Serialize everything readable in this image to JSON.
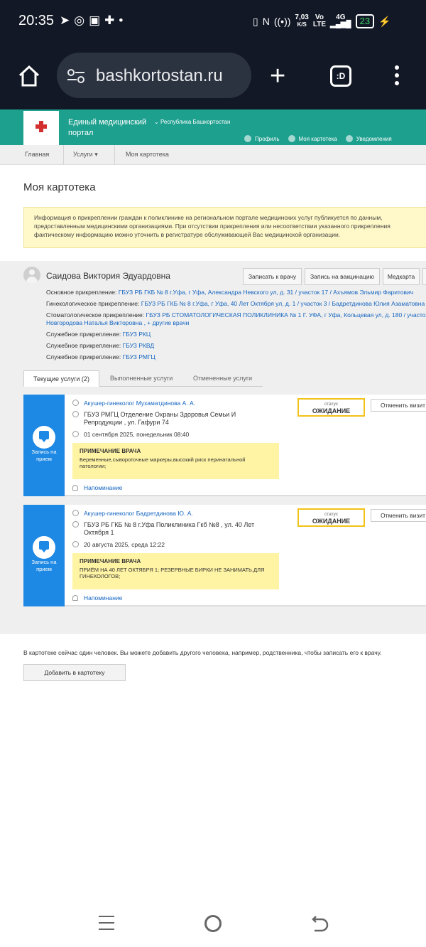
{
  "status_bar": {
    "time": "20:35",
    "notif_icons": [
      "telegram-icon",
      "whatsapp-icon",
      "app-icon",
      "plus-icon",
      "dot-icon"
    ],
    "net_speed_value": "7,03",
    "net_speed_unit": "K/S",
    "volte_top": "Vo",
    "volte_bottom": "LTE",
    "network": "4G",
    "battery": "23"
  },
  "browser": {
    "url": "bashkortostan.ru",
    "tabs_label": ":D"
  },
  "site_header": {
    "portal_name": "Единый медицинский портал",
    "region": "Республика Башкортостан",
    "links": [
      "Профиль",
      "Моя картотека",
      "Уведомления"
    ]
  },
  "breadcrumb": [
    "Главная",
    "Услуги",
    "Моя картотека"
  ],
  "page_title": "Моя картотека",
  "info_text": "Информация о прикреплении граждан к поликлинике на региональном портале медицинских услуг публикуется по данным, предоставленным медицинскими организациями. При отсутствии прикрепления или несоответствии указанного прикрепления фактическому информацию можно уточнить в регистратуре обслуживающей Вас медицинской организации.",
  "patient": {
    "name": "Саидова Виктория Эдуардовна",
    "buttons": [
      "Записать к врачу",
      "Запись на вакцинацию",
      "Медкарта"
    ],
    "attachments": [
      {
        "label": "Основное прикрепление:",
        "value": "ГБУЗ РБ ГКБ № 8 г.Уфа, г Уфа, Александра Невского ул, д. 31 / участок 17 / Ахъямов Эльмир Фаритович"
      },
      {
        "label": "Гинекологическое прикрепление:",
        "value": "ГБУЗ РБ ГКБ № 8 г.Уфа, г Уфа, 40 Лет Октября ул, д. 1 / участок 3 / Бадретдинова Юлия Азаматовна"
      },
      {
        "label": "Стоматологическое прикрепление:",
        "value": "ГБУЗ РБ СТОМАТОЛОГИЧЕСКАЯ ПОЛИКЛИНИКА № 1 Г. УФА, г Уфа, Кольцевая ул, д. 180 / участок",
        "value2": "Новгородова Наталья Викторовна",
        "more": ", + другие врачи"
      },
      {
        "label": "Служебное прикрепление:",
        "value": "ГБУЗ РКЦ"
      },
      {
        "label": "Служебное прикрепление:",
        "value": "ГБУЗ РКВД"
      },
      {
        "label": "Служебное прикрепление:",
        "value": "ГБУЗ РМГЦ"
      }
    ]
  },
  "tabs": [
    "Текущие услуги (2)",
    "Выполненные услуги",
    "Отмененные услуги"
  ],
  "visits": [
    {
      "type": "Запись на прием",
      "doctor": "Акушер-гинеколог Мухаматдинова А. А.",
      "address": "ГБУЗ РМГЦ Отделение Охраны Здоровья Семьи И Репродукции , ул. Гафури 74",
      "datetime": "01 сентября 2025, понедельник 08:40",
      "note_title": "ПРИМЕЧАНИЕ ВРАЧА",
      "note_text": "Беременные,сывороточные маркеры,высокий риск перинатальной патологии;",
      "reminder": "Напоминание",
      "status_label": "статус",
      "status_value": "ОЖИДАНИЕ",
      "cancel": "Отменить визит"
    },
    {
      "type": "Запись на прием",
      "doctor": "Акушер-гинеколог Бадретдинова Ю. А.",
      "address": "ГБУЗ РБ ГКБ № 8 г.Уфа Поликлиника Гкб №8 , ул. 40 Лет Октября 1",
      "datetime": "20 августа 2025, среда 12:22",
      "note_title": "ПРИМЕЧАНИЕ ВРАЧА",
      "note_text": "ПРИЁМ НА 40 ЛЕТ ОКТЯБРЯ 1; РЕЗЕРВНЫЕ БИРКИ НЕ ЗАНИМАТЬ.ДЛЯ ГИНЕКОЛОГОВ;",
      "reminder": "Напоминание",
      "status_label": "статус",
      "status_value": "ОЖИДАНИЕ",
      "cancel": "Отменить визит"
    }
  ],
  "footer": {
    "text": "В картотеке сейчас один человек. Вы можете добавить другого человека, например, родственника, чтобы записать его к врачу.",
    "add_button": "Добавить в картотеку"
  },
  "colors": {
    "teal": "#1ea08f",
    "blue": "#1e88e5",
    "yellow_border": "#f2c218",
    "link": "#1565c0"
  }
}
